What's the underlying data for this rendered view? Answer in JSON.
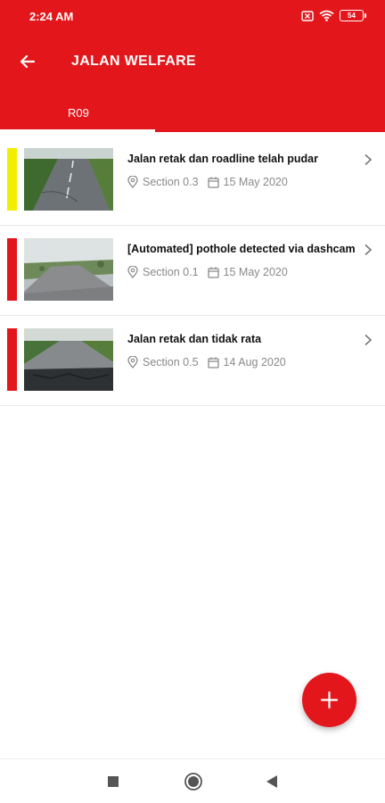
{
  "status_bar": {
    "time": "2:24 AM",
    "battery": "54",
    "icons": [
      "notification-x-icon",
      "wifi-icon",
      "battery-icon"
    ]
  },
  "app_bar": {
    "title": "JALAN WELFARE",
    "back_icon": "arrow-left-icon",
    "background": "#e3161b"
  },
  "tabs": [
    {
      "label": "R09",
      "selected": true
    }
  ],
  "reports": [
    {
      "title": "Jalan retak dan roadline telah pudar",
      "section": "Section 0.3",
      "date": "15 May 2020",
      "severity_color": "#f2ee00",
      "thumbnail": "road-photo-1"
    },
    {
      "title": "[Automated] pothole detected via dashcam",
      "section": "Section 0.1",
      "date": "15 May 2020",
      "severity_color": "#e3161b",
      "thumbnail": "road-photo-2"
    },
    {
      "title": "Jalan retak dan tidak rata",
      "section": "Section 0.5",
      "date": "14 Aug 2020",
      "severity_color": "#e3161b",
      "thumbnail": "road-photo-3"
    }
  ],
  "fab": {
    "icon": "plus-icon"
  },
  "nav_bar": {
    "buttons": [
      "recents-square-icon",
      "home-circle-icon",
      "back-triangle-icon"
    ]
  }
}
